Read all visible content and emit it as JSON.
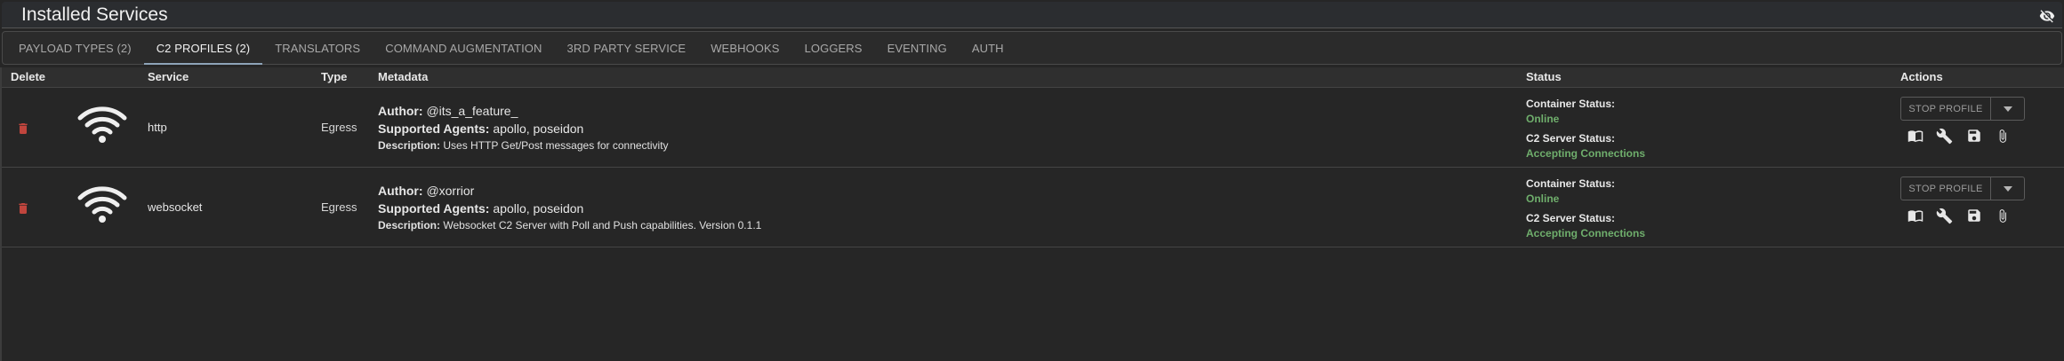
{
  "header": {
    "title": "Installed Services",
    "hide_icon": "eye-off-icon"
  },
  "tabs": [
    {
      "label": "PAYLOAD TYPES (2)",
      "active": false
    },
    {
      "label": "C2 PROFILES (2)",
      "active": true
    },
    {
      "label": "TRANSLATORS",
      "active": false
    },
    {
      "label": "COMMAND AUGMENTATION",
      "active": false
    },
    {
      "label": "3RD PARTY SERVICE",
      "active": false
    },
    {
      "label": "WEBHOOKS",
      "active": false
    },
    {
      "label": "LOGGERS",
      "active": false
    },
    {
      "label": "EVENTING",
      "active": false
    },
    {
      "label": "AUTH",
      "active": false
    }
  ],
  "table": {
    "columns": {
      "delete": "Delete",
      "service": "Service",
      "type": "Type",
      "metadata": "Metadata",
      "status": "Status",
      "actions": "Actions"
    },
    "labels": {
      "author": "Author:",
      "supported_agents": "Supported Agents:",
      "description": "Description:",
      "container_status": "Container Status:",
      "c2_server_status": "C2 Server Status:",
      "stop_profile": "STOP PROFILE"
    },
    "rows": [
      {
        "service": "http",
        "type": "Egress",
        "author": "@its_a_feature_",
        "supported_agents": "apollo, poseidon",
        "description": "Uses HTTP Get/Post messages for connectivity",
        "container_status": "Online",
        "c2_server_status": "Accepting Connections"
      },
      {
        "service": "websocket",
        "type": "Egress",
        "author": "@xorrior",
        "supported_agents": "apollo, poseidon",
        "description": "Websocket C2 Server with Poll and Push capabilities. Version 0.1.1",
        "container_status": "Online",
        "c2_server_status": "Accepting Connections"
      }
    ]
  },
  "colors": {
    "accent_status": "#6fae6c",
    "delete_red": "#c0453d",
    "background": "#262626"
  }
}
